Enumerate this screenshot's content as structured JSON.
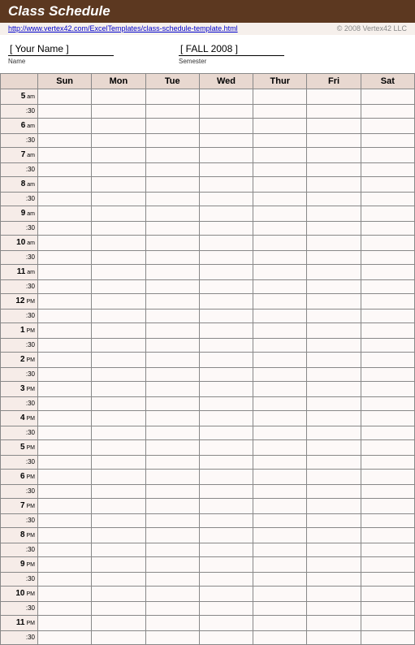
{
  "header": {
    "title": "Class Schedule",
    "url_text": "http://www.vertex42.com/ExcelTemplates/class-schedule-template.html",
    "copyright": "© 2008 Vertex42 LLC"
  },
  "info": {
    "name_value": "[ Your Name ]",
    "name_label": "Name",
    "semester_value": "[ FALL 2008 ]",
    "semester_label": "Semester"
  },
  "days": [
    "Sun",
    "Mon",
    "Tue",
    "Wed",
    "Thur",
    "Fri",
    "Sat"
  ],
  "hours": [
    {
      "h": "5",
      "p": "am"
    },
    {
      "h": "6",
      "p": "am"
    },
    {
      "h": "7",
      "p": "am"
    },
    {
      "h": "8",
      "p": "am"
    },
    {
      "h": "9",
      "p": "am"
    },
    {
      "h": "10",
      "p": "am"
    },
    {
      "h": "11",
      "p": "am"
    },
    {
      "h": "12",
      "p": "PM"
    },
    {
      "h": "1",
      "p": "PM"
    },
    {
      "h": "2",
      "p": "PM"
    },
    {
      "h": "3",
      "p": "PM"
    },
    {
      "h": "4",
      "p": "PM"
    },
    {
      "h": "5",
      "p": "PM"
    },
    {
      "h": "6",
      "p": "PM"
    },
    {
      "h": "7",
      "p": "PM"
    },
    {
      "h": "8",
      "p": "PM"
    },
    {
      "h": "9",
      "p": "PM"
    },
    {
      "h": "10",
      "p": "PM"
    },
    {
      "h": "11",
      "p": "PM"
    }
  ],
  "half_label": ":30"
}
